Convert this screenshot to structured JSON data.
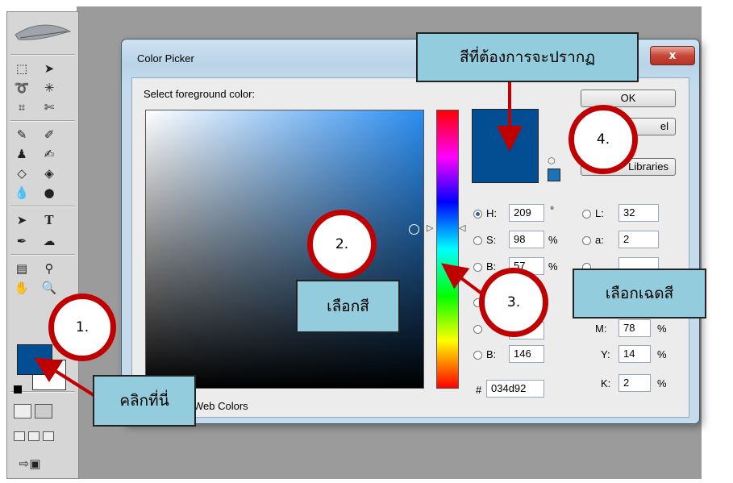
{
  "dialog": {
    "title": "Color Picker",
    "close_label": "x",
    "prompt": "Select foreground color:",
    "buttons": {
      "ok": "OK",
      "cancel": "el",
      "libraries": "Libraries"
    },
    "current_color": "#034d92",
    "web_colors_label": "Web Colors",
    "fields": {
      "h": {
        "label": "H:",
        "value": "209",
        "unit": "°",
        "selected": true
      },
      "s": {
        "label": "S:",
        "value": "98",
        "unit": "%"
      },
      "b_hsb": {
        "label": "B:",
        "value": "57",
        "unit": "%"
      },
      "b_rgb": {
        "label": "B:",
        "value": "146"
      },
      "l": {
        "label": "L:",
        "value": "32"
      },
      "a": {
        "label": "a:",
        "value": "2"
      },
      "m": {
        "label": "M:",
        "value": "78",
        "unit": "%"
      },
      "y": {
        "label": "Y:",
        "value": "14",
        "unit": "%"
      },
      "k": {
        "label": "K:",
        "value": "2",
        "unit": "%"
      },
      "hex": {
        "label": "#",
        "value": "034d92"
      }
    }
  },
  "annotations": {
    "step1": "1.",
    "step2": "2.",
    "step3": "3.",
    "step4": "4.",
    "click_here": "คลิกที่นี่",
    "choose_color": "เลือกสี",
    "choose_shade": "เลือกเฉดสี",
    "desired_color": "สีที่ต้องการจะปรากฏ"
  },
  "colors": {
    "accent_red": "#c00000",
    "callout_bg": "#93cddd",
    "foreground": "#034d92"
  },
  "toolbox": {
    "icons": [
      "marquee-icon",
      "move-icon",
      "lasso-icon",
      "magic-wand-icon",
      "crop-icon",
      "slice-icon",
      "healing-brush-icon",
      "brush-icon",
      "clone-stamp-icon",
      "history-brush-icon",
      "eraser-icon",
      "paint-bucket-icon",
      "blur-icon",
      "dodge-icon",
      "path-select-icon",
      "type-icon",
      "pen-icon",
      "shape-icon",
      "notes-icon",
      "eyedropper-icon",
      "hand-icon",
      "zoom-icon"
    ]
  }
}
